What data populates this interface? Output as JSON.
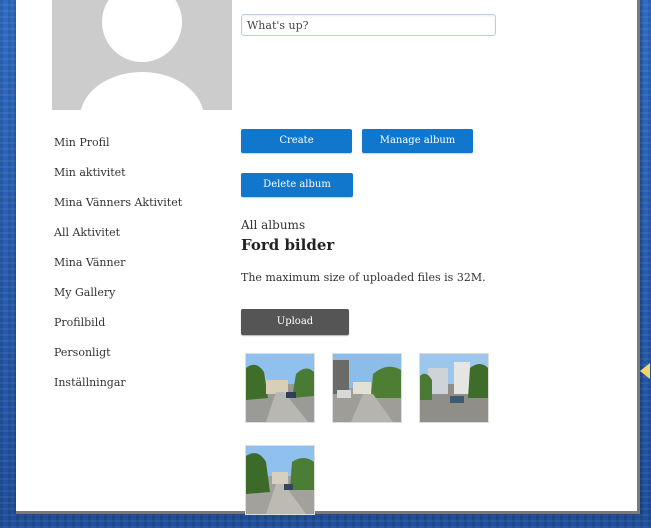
{
  "status": {
    "placeholder": "What's up?"
  },
  "nav": {
    "items": [
      {
        "label": "Min Profil"
      },
      {
        "label": "Min aktivitet"
      },
      {
        "label": "Mina Vänners Aktivitet"
      },
      {
        "label": "All Aktivitet"
      },
      {
        "label": "Mina Vänner"
      },
      {
        "label": "My Gallery"
      },
      {
        "label": "Profilbild"
      },
      {
        "label": "Personligt"
      },
      {
        "label": "Inställningar"
      }
    ]
  },
  "album": {
    "create_label": "Create",
    "manage_label": "Manage album",
    "delete_label": "Delete album",
    "breadcrumb": "All albums",
    "title": "Ford bilder",
    "max_size_text": "The maximum size of uploaded files is 32M.",
    "upload_label": "Upload"
  },
  "photos": [
    {
      "icon": "street-photo"
    },
    {
      "icon": "street-photo"
    },
    {
      "icon": "street-photo"
    },
    {
      "icon": "street-photo"
    }
  ],
  "colors": {
    "button_blue": "#1177cc",
    "button_dark": "#555555",
    "background_blue": "#2a5fb3"
  }
}
